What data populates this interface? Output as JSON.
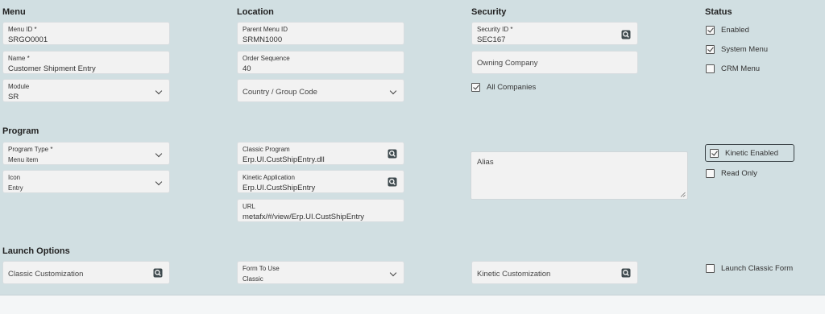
{
  "sections": {
    "menu": "Menu",
    "location": "Location",
    "security": "Security",
    "status": "Status",
    "program": "Program",
    "launch_options": "Launch Options"
  },
  "menu": {
    "menu_id": {
      "label": "Menu ID *",
      "value": "SRGO0001"
    },
    "name": {
      "label": "Name *",
      "value": "Customer Shipment Entry"
    },
    "module": {
      "label": "Module",
      "value": "SR"
    }
  },
  "location": {
    "parent_menu_id": {
      "label": "Parent Menu ID",
      "value": "SRMN1000"
    },
    "order_sequence": {
      "label": "Order Sequence",
      "value": "40"
    },
    "country_group": {
      "placeholder": "Country / Group Code"
    }
  },
  "security": {
    "security_id": {
      "label": "Security ID *",
      "value": "SEC167"
    },
    "owning_company": {
      "placeholder": "Owning Company"
    },
    "all_companies": {
      "label": "All Companies",
      "checked": true
    }
  },
  "status": {
    "enabled": {
      "label": "Enabled",
      "checked": true
    },
    "system_menu": {
      "label": "System Menu",
      "checked": true
    },
    "crm_menu": {
      "label": "CRM Menu",
      "checked": false
    }
  },
  "program": {
    "program_type": {
      "label": "Program Type *",
      "value": "Menu item"
    },
    "icon": {
      "label": "Icon",
      "value": "Entry"
    },
    "classic_program": {
      "label": "Classic Program",
      "value": "Erp.UI.CustShipEntry.dll"
    },
    "kinetic_application": {
      "label": "Kinetic Application",
      "value": "Erp.UI.CustShipEntry"
    },
    "url": {
      "label": "URL",
      "value": "metafx/#/view/Erp.UI.CustShipEntry"
    },
    "alias": {
      "placeholder": "Alias"
    },
    "kinetic_enabled": {
      "label": "Kinetic Enabled",
      "checked": true
    },
    "read_only": {
      "label": "Read Only",
      "checked": false
    }
  },
  "launch": {
    "classic_customization": {
      "placeholder": "Classic Customization"
    },
    "form_to_use": {
      "label": "Form To Use",
      "value": "Classic"
    },
    "kinetic_customization": {
      "placeholder": "Kinetic Customization"
    },
    "launch_classic_form": {
      "label": "Launch Classic Form",
      "checked": false
    }
  },
  "icons": {
    "search": "search-icon",
    "dropdown": "chevron-down-icon"
  }
}
